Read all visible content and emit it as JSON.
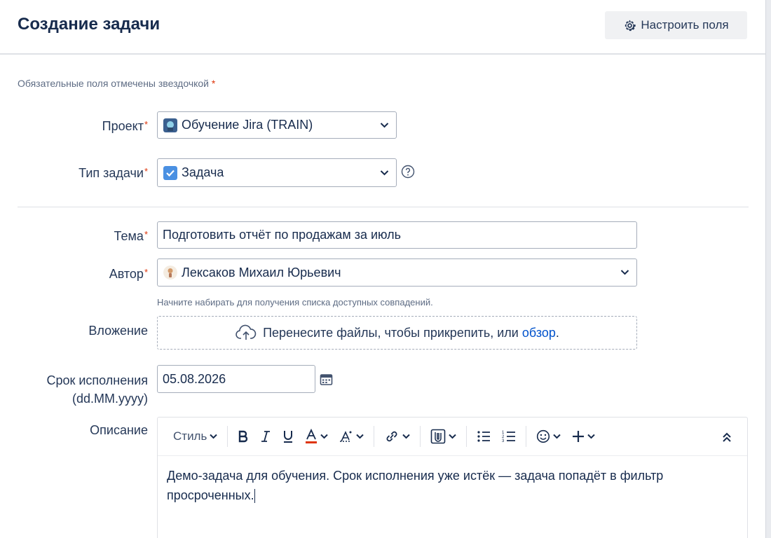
{
  "header": {
    "title": "Создание задачи",
    "configure_label": "Настроить поля"
  },
  "required_note": {
    "text": "Обязательные поля отмечены звездочкой",
    "star": "*"
  },
  "fields": {
    "project": {
      "label": "Проект",
      "star": "*",
      "value": "Обучение Jira (TRAIN)",
      "icon": "project-avatar-icon"
    },
    "issue_type": {
      "label": "Тип задачи",
      "star": "*",
      "value": "Задача",
      "icon": "task-checkbox-icon",
      "help_icon": "help-circle-icon"
    },
    "summary": {
      "label": "Тема",
      "star": "*",
      "value": "Подготовить отчёт по продажам за июль"
    },
    "reporter": {
      "label": "Автор",
      "star": "*",
      "value": "Лексаков Михаил Юрьевич",
      "icon": "user-avatar-icon",
      "hint": "Начните набирать для получения списка доступных совпадений."
    },
    "attachment": {
      "label": "Вложение",
      "drop_text": "Перенесите файлы, чтобы прикрепить, или",
      "browse_link": "обзор",
      "suffix": "."
    },
    "due_date": {
      "label_line1": "Срок исполнения",
      "label_line2": "(dd.MM.yyyy)",
      "value": "05.08.2026",
      "icon": "calendar-icon"
    },
    "description": {
      "label": "Описание",
      "toolbar": {
        "style_label": "Стиль",
        "buttons": [
          "bold-icon",
          "italic-icon",
          "underline-icon",
          "text-color-icon",
          "more-formatting-icon",
          "link-icon",
          "attachment-icon",
          "bullet-list-icon",
          "numbered-list-icon",
          "emoji-icon",
          "insert-plus-icon",
          "collapse-toolbar-icon"
        ]
      },
      "text_line1": "Демо-задача для обучения. Срок исполнения уже истёк — задача попадёт в фильтр",
      "text_line2": "просроченных."
    }
  },
  "colors": {
    "accent": "#0052cc",
    "required": "#de350b",
    "text": "#172b4d",
    "text_color_underline": "#de350b"
  }
}
